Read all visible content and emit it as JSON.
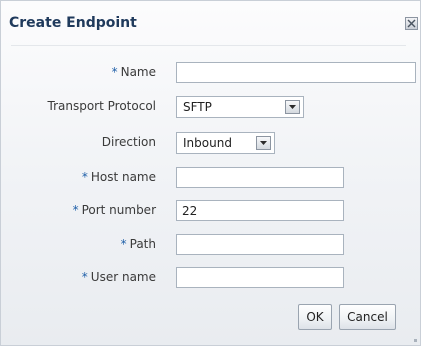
{
  "dialog": {
    "title": "Create Endpoint",
    "close_icon": "close-x-icon"
  },
  "fields": {
    "required_marker": "*",
    "name": {
      "label": "Name",
      "value": ""
    },
    "transport_protocol": {
      "label": "Transport Protocol",
      "value": "SFTP"
    },
    "direction": {
      "label": "Direction",
      "value": "Inbound"
    },
    "host_name": {
      "label": "Host name",
      "value": ""
    },
    "port_number": {
      "label": "Port number",
      "value": "22"
    },
    "path": {
      "label": "Path",
      "value": ""
    },
    "user_name": {
      "label": "User name",
      "value": ""
    }
  },
  "buttons": {
    "ok": "OK",
    "cancel": "Cancel"
  },
  "colors": {
    "title": "#1f3a5c",
    "required_marker": "#1f5fa8"
  }
}
